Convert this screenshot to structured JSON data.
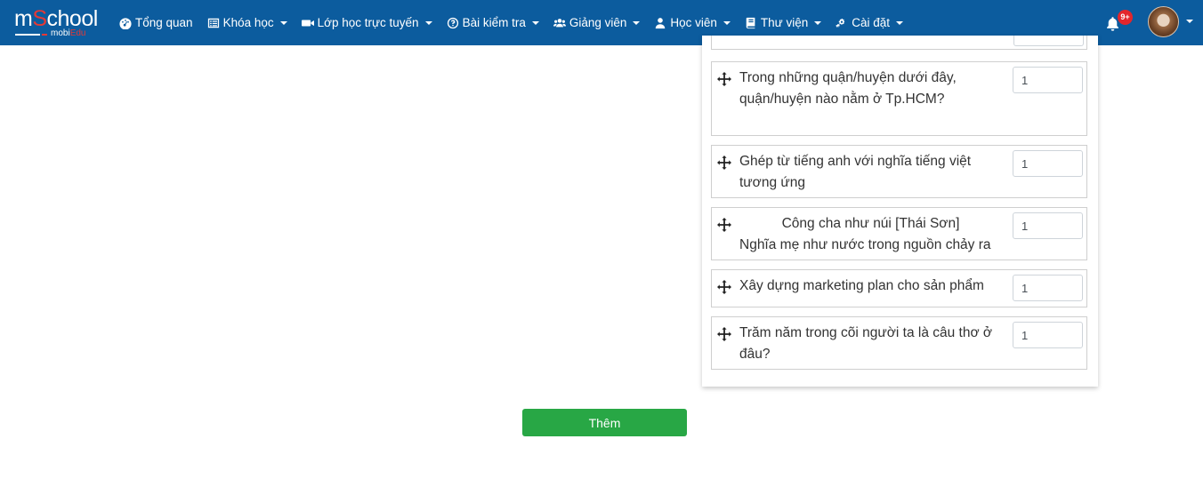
{
  "brand": {
    "logo_pre": "m",
    "logo_s": "S",
    "logo_post": "chool",
    "sub_pre": "mobi",
    "sub_red": "Edu",
    "accent": "#0c5c9e",
    "brand_red": "#e53935"
  },
  "nav": {
    "items": [
      {
        "label": "Tổng quan",
        "icon": "dashboard-icon",
        "dropdown": false
      },
      {
        "label": "Khóa học",
        "icon": "list-icon",
        "dropdown": true
      },
      {
        "label": "Lớp học trực tuyến",
        "icon": "video-camera-icon",
        "dropdown": true
      },
      {
        "label": "Bài kiểm tra",
        "icon": "question-circle-icon",
        "dropdown": true
      },
      {
        "label": "Giảng viên",
        "icon": "users-icon",
        "dropdown": true
      },
      {
        "label": "Học viên",
        "icon": "user-icon",
        "dropdown": true
      },
      {
        "label": "Thư viện",
        "icon": "book-icon",
        "dropdown": true
      },
      {
        "label": "Cài đặt",
        "icon": "cogs-icon",
        "dropdown": true
      }
    ],
    "notification_count": "9+"
  },
  "questions": [
    {
      "text": "Trong những quận/huyện dưới đây, quận/huyện nào nằm ở Tp.HCM?",
      "score": "1"
    },
    {
      "text": "Ghép từ tiếng anh với nghĩa tiếng việt tương ứng",
      "score": "1"
    },
    {
      "line1": "Công cha như núi [Thái Sơn]",
      "line2": "Nghĩa mẹ như nước trong nguồn chảy ra",
      "score": "1"
    },
    {
      "text": "Xây dựng marketing plan cho sản phẩm",
      "score": "1"
    },
    {
      "text": "Trăm năm trong cõi người ta là câu thơ ở đâu?",
      "score": "1"
    }
  ],
  "actions": {
    "add_label": "Thêm",
    "add_color": "#28a745"
  }
}
